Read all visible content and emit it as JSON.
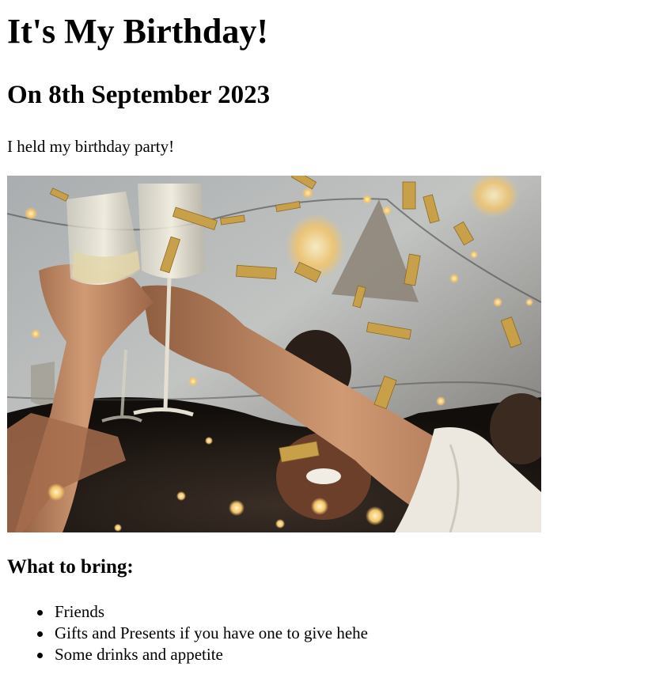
{
  "page": {
    "title": "It's My Birthday!",
    "subtitle": "On 8th September 2023",
    "intro": "I held my birthday party!"
  },
  "photo": {
    "alt": "Friends raising champagne glasses in a toast with gold confetti falling",
    "colors": {
      "background": "#b9bdbf",
      "wall_shadow": "#2b2622",
      "skin": "#c98f6a",
      "skin_shadow": "#8a5a3e",
      "sleeve": "#ece7df",
      "confetti": "#c9a04a",
      "bokeh": "#ffd88a",
      "glass": "#e8e3d6"
    }
  },
  "bring": {
    "heading": "What to bring:",
    "items": [
      "Friends",
      "Gifts and Presents if you have one to give hehe",
      "Some drinks and appetite"
    ]
  }
}
